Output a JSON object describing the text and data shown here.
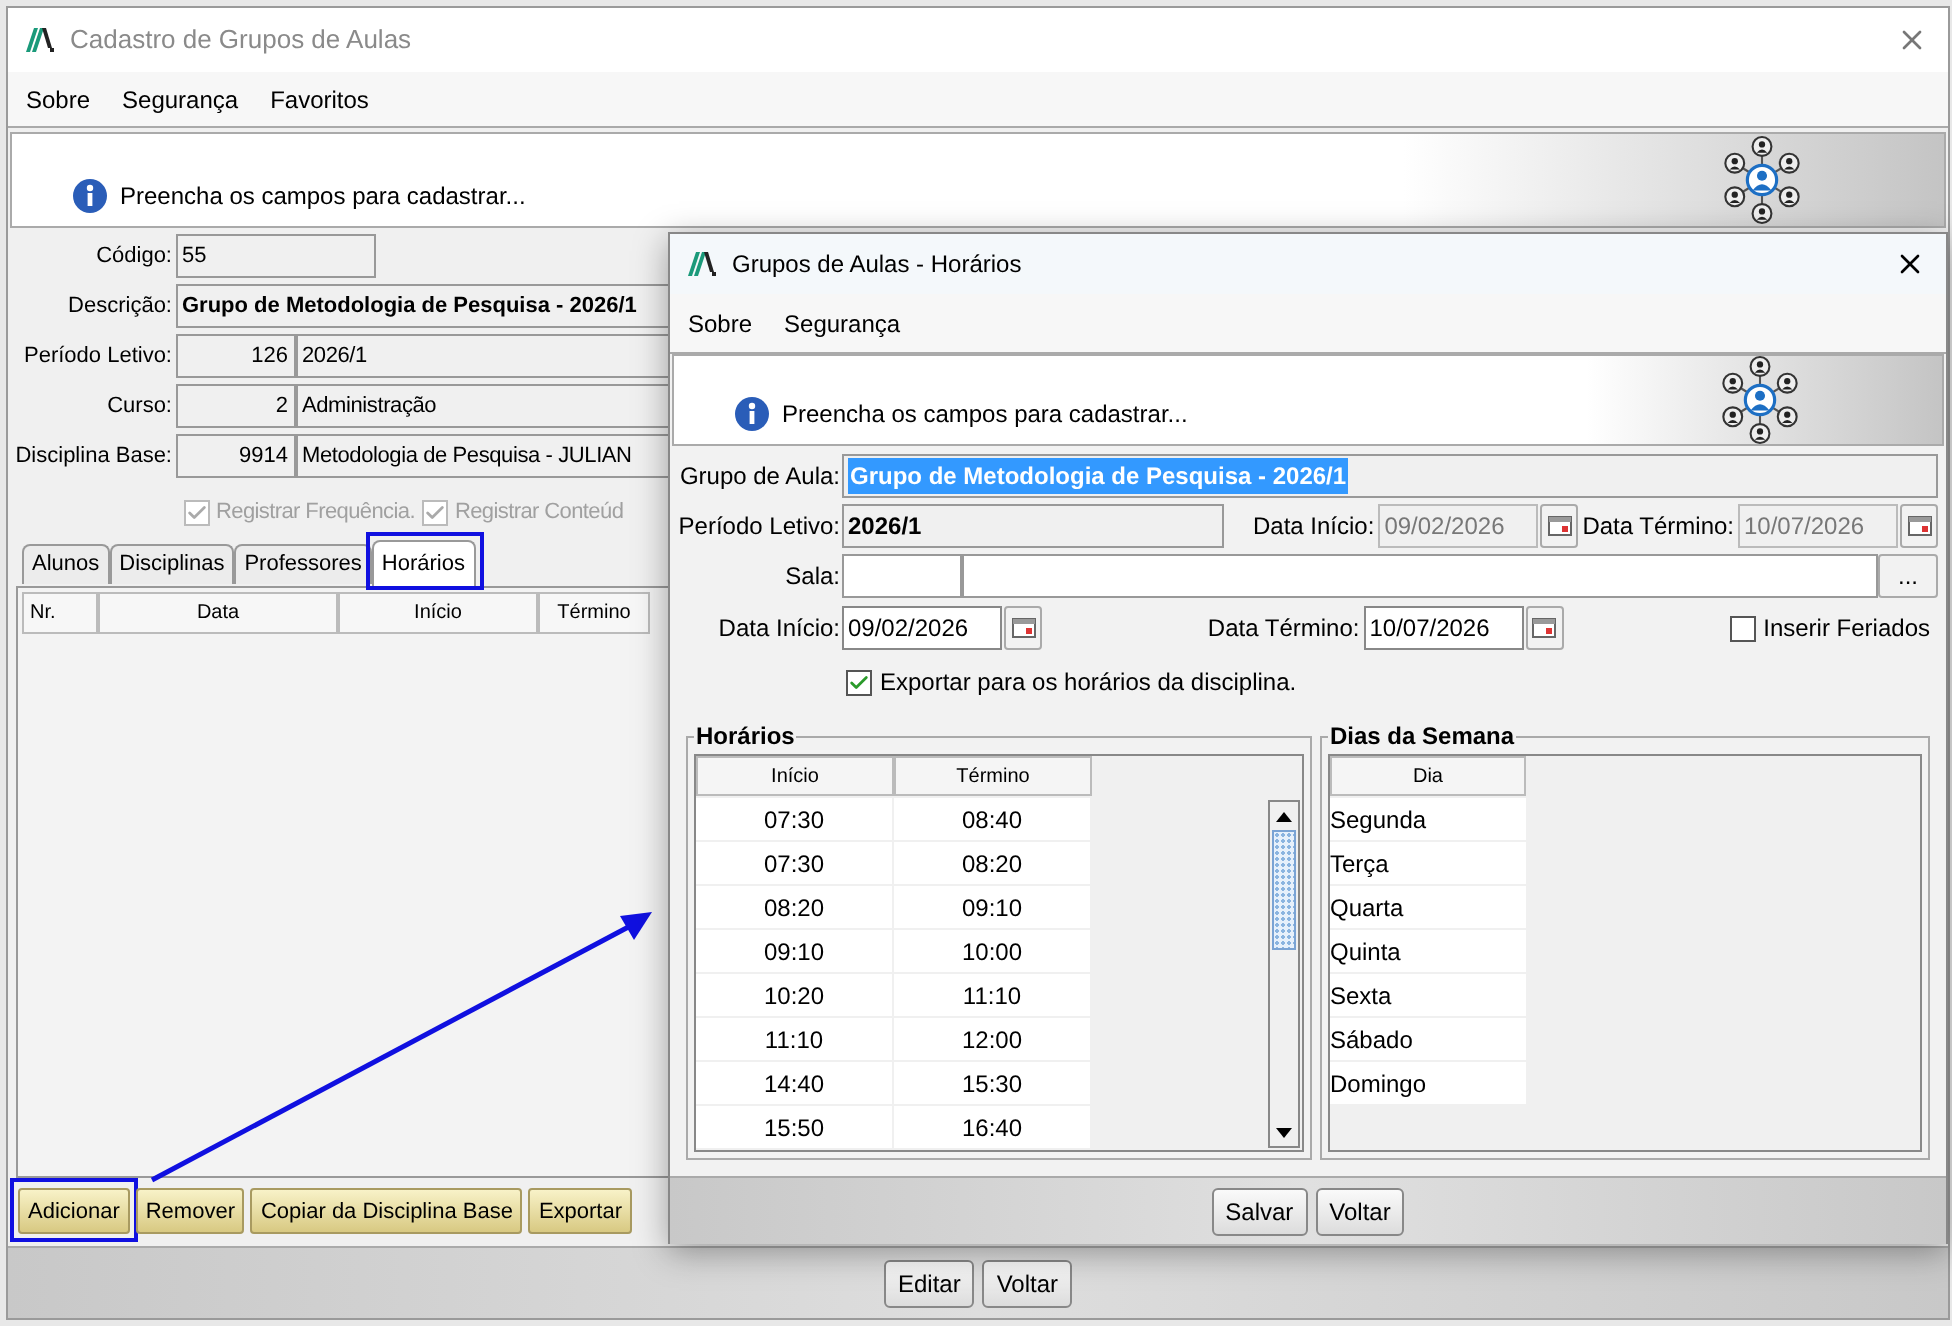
{
  "main_window": {
    "title": "Cadastro de Grupos de Aulas",
    "menu": [
      "Sobre",
      "Segurança",
      "Favoritos"
    ],
    "info_message": "Preencha os campos para cadastrar...",
    "fields": [
      {
        "label": "Código:",
        "kind": "code",
        "value": "55"
      },
      {
        "label": "Descrição:",
        "kind": "title",
        "value": "Grupo de Metodologia de Pesquisa - 2026/1"
      },
      {
        "label": "Período Letivo:",
        "kind": "lookup",
        "code": "126",
        "value": "2026/1"
      },
      {
        "label": "Curso:",
        "kind": "lookup",
        "code": "2",
        "value": "Administração"
      },
      {
        "label": "Disciplina Base:",
        "kind": "lookup",
        "code": "9914",
        "value": "Metodologia de Pesquisa - JULIAN"
      }
    ],
    "options": [
      {
        "label": "Registrar Frequência.",
        "checked": true,
        "disabled": true
      },
      {
        "label": "Registrar Conteúd",
        "checked": true,
        "disabled": true
      }
    ],
    "tabs": [
      {
        "label": "Alunos",
        "selected": false,
        "highlighted": false
      },
      {
        "label": "Disciplinas",
        "selected": false,
        "highlighted": false
      },
      {
        "label": "Professores",
        "selected": false,
        "highlighted": false
      },
      {
        "label": "Horários",
        "selected": true,
        "highlighted": true
      }
    ],
    "table": {
      "columns": [
        "Nr.",
        "Data",
        "Início",
        "Término"
      ]
    },
    "actions": [
      {
        "label": "Adicionar",
        "highlighted": true
      },
      {
        "label": "Remover",
        "highlighted": false
      },
      {
        "label": "Copiar da Disciplina Base",
        "highlighted": false
      },
      {
        "label": "Exportar",
        "highlighted": false
      }
    ],
    "buttons": [
      "Editar",
      "Voltar"
    ]
  },
  "dialog": {
    "title": "Grupos de Aulas - Horários",
    "menu": [
      "Sobre",
      "Segurança"
    ],
    "info_message": "Preencha os campos para cadastrar...",
    "group": {
      "label": "Grupo de Aula:",
      "value": "Grupo de Metodologia de Pesquisa - 2026/1",
      "text_selected": true
    },
    "period": {
      "label": "Período Letivo:",
      "value": "2026/1"
    },
    "period_start": {
      "label": "Data Início:",
      "value": "09/02/2026",
      "disabled": true
    },
    "period_end": {
      "label": "Data Término:",
      "value": "10/07/2026",
      "disabled": true
    },
    "room": {
      "label": "Sala:",
      "browse": "..."
    },
    "start": {
      "label": "Data Início:",
      "value": "09/02/2026",
      "disabled": false
    },
    "end": {
      "label": "Data Término:",
      "value": "10/07/2026",
      "disabled": false
    },
    "holidays": {
      "label": "Inserir Feriados",
      "checked": false
    },
    "export": {
      "label": "Exportar para os horários da disciplina.",
      "checked": true
    },
    "schedules": {
      "title": "Horários",
      "columns": [
        "Início",
        "Término"
      ],
      "rows": [
        [
          "07:30",
          "08:40"
        ],
        [
          "07:30",
          "08:20"
        ],
        [
          "08:20",
          "09:10"
        ],
        [
          "09:10",
          "10:00"
        ],
        [
          "10:20",
          "11:10"
        ],
        [
          "11:10",
          "12:00"
        ],
        [
          "14:40",
          "15:30"
        ],
        [
          "15:50",
          "16:40"
        ]
      ]
    },
    "weekdays": {
      "title": "Dias da Semana",
      "columns": [
        "Dia"
      ],
      "rows": [
        "Segunda",
        "Terça",
        "Quarta",
        "Quinta",
        "Sexta",
        "Sábado",
        "Domingo"
      ]
    },
    "buttons": [
      "Salvar",
      "Voltar"
    ]
  }
}
